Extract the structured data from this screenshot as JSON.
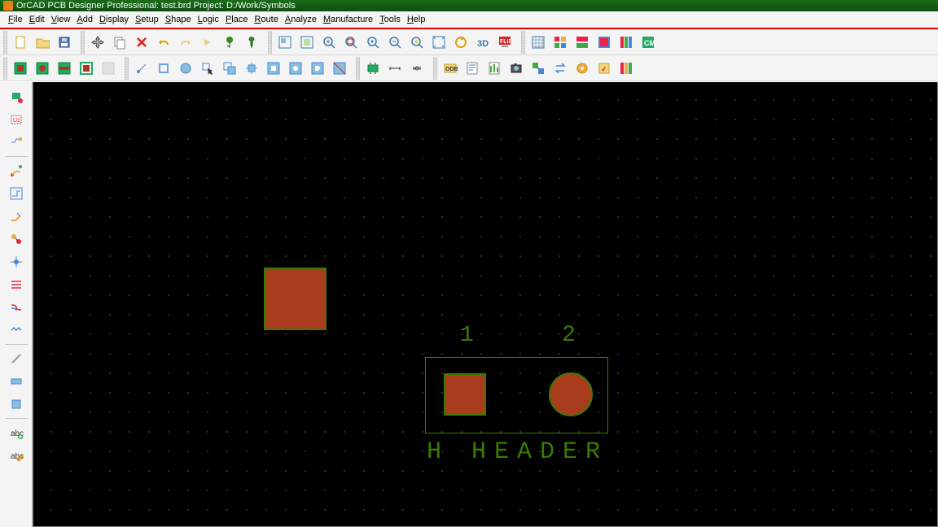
{
  "title": "OrCAD PCB Designer Professional: test.brd   Project: D:/Work/Symbols",
  "menu": [
    "File",
    "Edit",
    "View",
    "Add",
    "Display",
    "Setup",
    "Shape",
    "Logic",
    "Place",
    "Route",
    "Analyze",
    "Manufacture",
    "Tools",
    "Help"
  ],
  "menu_keys": [
    "F",
    "E",
    "V",
    "A",
    "D",
    "S",
    "S",
    "L",
    "P",
    "R",
    "A",
    "M",
    "T",
    "H"
  ],
  "board": {
    "pin1_label": "1",
    "pin2_label": "2",
    "refdes": "H",
    "device": "HEADER"
  },
  "colors": {
    "pad_fill": "#a83c1c",
    "pad_outline": "#3b7a00",
    "silk_text": "#3b7a00"
  },
  "left_tools": [
    "placement-edit",
    "symbol-edit",
    "net-edit",
    "route",
    "autoroute",
    "slide",
    "via",
    "fanout",
    "spread",
    "diff-pair",
    "delay",
    "cline",
    "connect",
    "shape",
    "text-add",
    "text-edit"
  ],
  "row1": [
    {
      "name": "new-file",
      "svg": "file-new"
    },
    {
      "name": "open-file",
      "svg": "folder"
    },
    {
      "name": "save-file",
      "svg": "disk"
    },
    {
      "sep": true
    },
    {
      "name": "move",
      "svg": "move"
    },
    {
      "name": "copy",
      "svg": "copy"
    },
    {
      "name": "delete",
      "svg": "x-red"
    },
    {
      "name": "undo",
      "svg": "undo"
    },
    {
      "name": "redo",
      "svg": "redo",
      "disabled": true
    },
    {
      "name": "next",
      "svg": "next",
      "disabled": true
    },
    {
      "name": "goto",
      "svg": "ball-green"
    },
    {
      "name": "pin",
      "svg": "pushpin"
    },
    {
      "sep": true
    },
    {
      "name": "zoom-window",
      "svg": "zwin"
    },
    {
      "name": "zoom-fit",
      "svg": "zfit"
    },
    {
      "name": "zoom-in",
      "svg": "zin"
    },
    {
      "name": "zoom-out-sel",
      "svg": "zoutsel"
    },
    {
      "name": "zoom-center",
      "svg": "zcenter"
    },
    {
      "name": "zoom-out",
      "svg": "zout"
    },
    {
      "name": "zoom-prev",
      "svg": "zprev"
    },
    {
      "name": "zoom-full",
      "svg": "zfull"
    },
    {
      "name": "refresh",
      "svg": "refresh"
    },
    {
      "name": "3d-view",
      "svg": "3d"
    },
    {
      "name": "flip",
      "svg": "flip"
    },
    {
      "sep": true
    },
    {
      "name": "grid-toggle",
      "svg": "grid"
    },
    {
      "name": "color1",
      "svg": "palette1"
    },
    {
      "name": "color2",
      "svg": "palette2"
    },
    {
      "name": "color3",
      "svg": "palette3"
    },
    {
      "name": "color4",
      "svg": "palette4"
    },
    {
      "name": "cm",
      "svg": "cm"
    }
  ],
  "row2": [
    {
      "name": "layer-top",
      "svg": "layer-g"
    },
    {
      "name": "layer-plane",
      "svg": "layer-g2"
    },
    {
      "name": "layer-bottom",
      "svg": "layer-g3"
    },
    {
      "name": "layer-outline",
      "svg": "layer-g4"
    },
    {
      "name": "layer-disabled",
      "svg": "layer-grey",
      "disabled": true
    },
    {
      "sep": true
    },
    {
      "name": "shape-point",
      "svg": "pt"
    },
    {
      "name": "shape-rect",
      "svg": "sq"
    },
    {
      "name": "shape-circle",
      "svg": "circ"
    },
    {
      "name": "shape-pick",
      "svg": "pick"
    },
    {
      "name": "shape-copy",
      "svg": "dupshape"
    },
    {
      "name": "shape-expand",
      "svg": "expand"
    },
    {
      "name": "shape-void-rect",
      "svg": "voidsq"
    },
    {
      "name": "shape-void-circ",
      "svg": "voidcirc"
    },
    {
      "name": "shape-void-poly",
      "svg": "voidpoly"
    },
    {
      "name": "shape-trim",
      "svg": "trim"
    },
    {
      "sep": true
    },
    {
      "name": "place-component",
      "svg": "comp"
    },
    {
      "name": "dim-h",
      "svg": "dimh"
    },
    {
      "name": "dim-v",
      "svg": "dimv"
    },
    {
      "sep": true
    },
    {
      "name": "odb-out",
      "svg": "odb"
    },
    {
      "name": "design-check",
      "svg": "dcheck"
    },
    {
      "name": "report",
      "svg": "report"
    },
    {
      "name": "camera",
      "svg": "camera"
    },
    {
      "name": "crossprobe",
      "svg": "xprobe"
    },
    {
      "name": "swap",
      "svg": "swap"
    },
    {
      "name": "highlight",
      "svg": "highlight"
    },
    {
      "name": "drc-check",
      "svg": "drc"
    },
    {
      "name": "layers",
      "svg": "layers"
    }
  ]
}
